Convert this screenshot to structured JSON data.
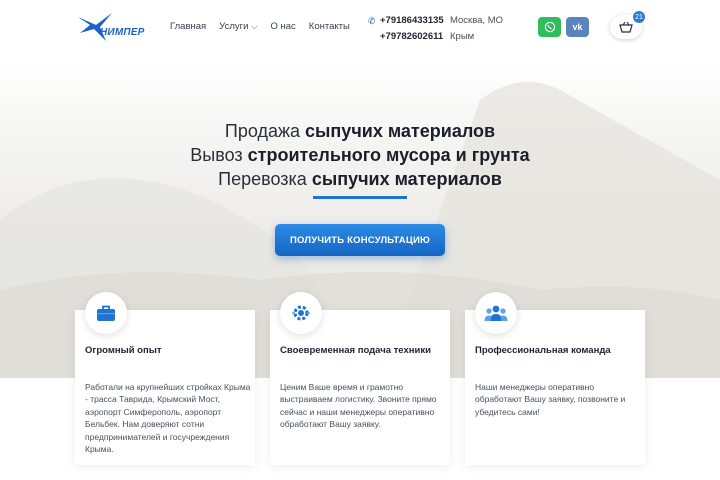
{
  "header": {
    "logo_text": "НИМПЕР",
    "nav": [
      {
        "label": "Главная"
      },
      {
        "label": "Услуги"
      },
      {
        "label": "О нас"
      },
      {
        "label": "Контакты"
      }
    ],
    "phones": [
      {
        "number": "+79186433135",
        "location": "Москва, МО"
      },
      {
        "number": "+79782602611",
        "location": "Крым"
      }
    ],
    "messengers": {
      "whatsapp_icon": "whatsapp-icon",
      "vk_label": "vk"
    },
    "cart_count": "21"
  },
  "hero": {
    "lines": [
      {
        "normal": "Продажа ",
        "bold": "сыпучих материалов"
      },
      {
        "normal": "Вывоз ",
        "bold": "строительного мусора и грунта"
      },
      {
        "normal": "Перевозка ",
        "bold": "сыпучих материалов"
      }
    ],
    "cta_label": "ПОЛУЧИТЬ КОНСУЛЬТАЦИЮ"
  },
  "features": [
    {
      "icon": "briefcase-icon",
      "title": "Огромный опыт",
      "text": "Работали на крупнейших стройках Крыма - трасса Таврида, Крымский Мост, аэропорт Симферополь, аэропорт Бельбек. Нам доверяют сотни предпринимателей и госучреждения Крыма."
    },
    {
      "icon": "gear-icon",
      "title": "Своевременная подача техники",
      "text": "Ценим Ваше время и грамотно выстраиваем логистику. Звоните прямо сейчас и наши менеджеры оперативно обработают Вашу заявку."
    },
    {
      "icon": "team-icon",
      "title": "Профессиональная команда",
      "text": "Наши менеджеры оперативно обработают Вашу заявку, позвоните и убедитесь сами!"
    }
  ],
  "colors": {
    "accent": "#1f73d1",
    "whatsapp": "#2fbe5b",
    "vk": "#5a84be"
  }
}
